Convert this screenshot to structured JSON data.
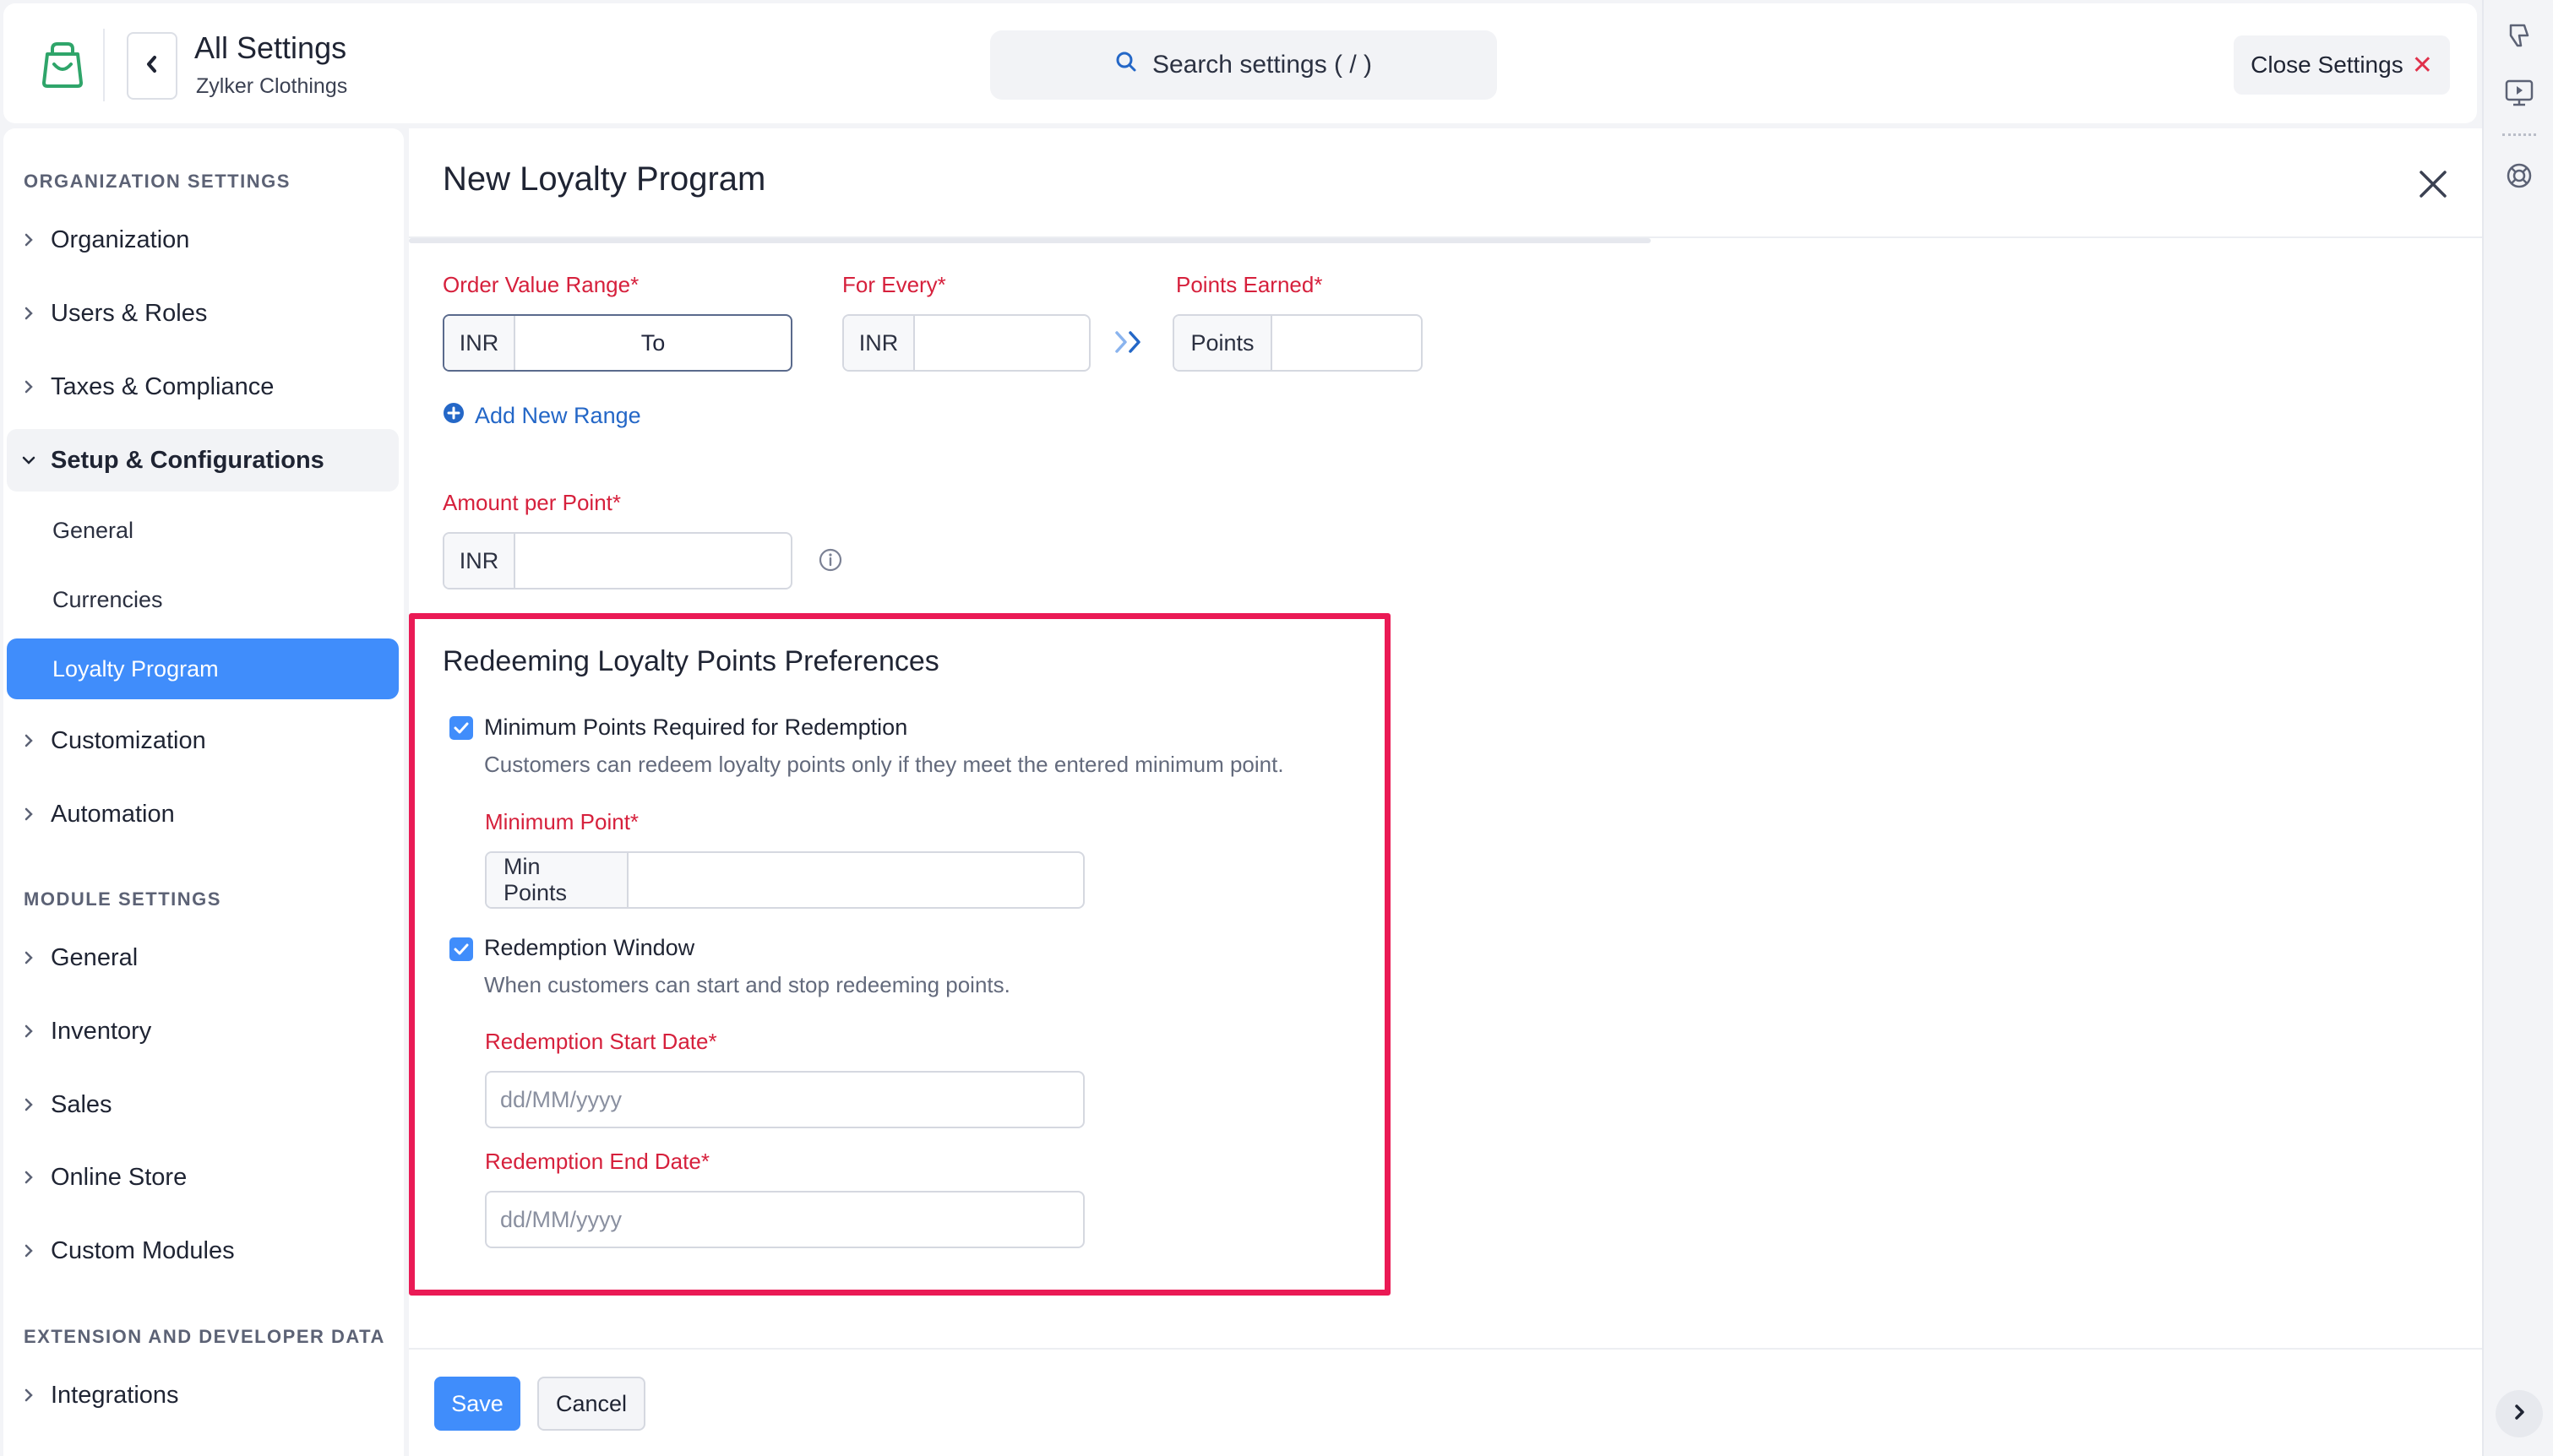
{
  "header": {
    "title": "All Settings",
    "org_name": "Zylker Clothings",
    "search_placeholder": "Search settings ( / )",
    "close_label": "Close Settings"
  },
  "sidebar": {
    "org_heading": "ORGANIZATION SETTINGS",
    "org_items": [
      "Organization",
      "Users & Roles",
      "Taxes & Compliance"
    ],
    "setup_label": "Setup & Configurations",
    "setup_subitems": [
      "General",
      "Currencies",
      "Loyalty Program"
    ],
    "active_subitem": "Loyalty Program",
    "more_items": [
      "Customization",
      "Automation"
    ],
    "module_heading": "MODULE SETTINGS",
    "module_items": [
      "General",
      "Inventory",
      "Sales",
      "Online Store",
      "Custom Modules"
    ],
    "ext_heading": "EXTENSION AND DEVELOPER DATA",
    "ext_items": [
      "Integrations"
    ]
  },
  "panel": {
    "title": "New Loyalty Program",
    "order_value_label": "Order Value Range*",
    "order_value_prefix": "INR",
    "order_value_to": "To",
    "for_every_label": "For Every*",
    "for_every_prefix": "INR",
    "points_earned_label": "Points Earned*",
    "points_prefix": "Points",
    "add_range": "Add New Range",
    "amount_label": "Amount per Point*",
    "amount_prefix": "INR",
    "redeem": {
      "title": "Redeeming Loyalty Points Preferences",
      "min_points_checkbox": "Minimum Points Required for Redemption",
      "min_points_checked": true,
      "min_points_desc": "Customers can redeem loyalty points only if they meet the entered minimum point.",
      "min_point_label": "Minimum Point*",
      "min_point_prefix": "Min Points",
      "window_checkbox": "Redemption Window",
      "window_checked": true,
      "window_desc": "When customers can start and stop redeeming points.",
      "start_label": "Redemption Start Date*",
      "start_placeholder": "dd/MM/yyyy",
      "end_label": "Redemption End Date*",
      "end_placeholder": "dd/MM/yyyy"
    },
    "save_label": "Save",
    "cancel_label": "Cancel"
  },
  "colors": {
    "accent": "#408dfb",
    "required": "#d6203c",
    "highlight": "#ea1a55"
  }
}
